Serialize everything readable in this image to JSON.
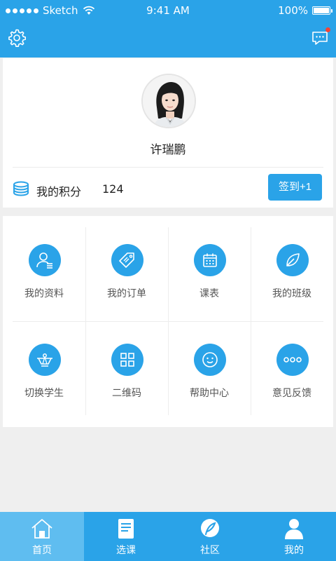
{
  "status_bar": {
    "carrier": "Sketch",
    "time": "9:41 AM",
    "battery": "100%"
  },
  "header": {
    "settings_icon": "gear-icon",
    "messages_icon": "message-icon",
    "has_unread": true
  },
  "profile": {
    "name": "许瑞鹏",
    "points_label": "我的积分",
    "points_value": "124",
    "checkin_label": "签到+1"
  },
  "menu": {
    "items": [
      {
        "label": "我的资料",
        "icon": "profile-icon"
      },
      {
        "label": "我的订单",
        "icon": "tag-icon"
      },
      {
        "label": "课表",
        "icon": "calendar-icon"
      },
      {
        "label": "我的班级",
        "icon": "leaf-icon"
      },
      {
        "label": "切换学生",
        "icon": "switch-icon"
      },
      {
        "label": "二维码",
        "icon": "qrcode-icon"
      },
      {
        "label": "帮助中心",
        "icon": "smile-icon"
      },
      {
        "label": "意见反馈",
        "icon": "more-icon"
      }
    ]
  },
  "tabbar": {
    "tabs": [
      {
        "label": "首页",
        "icon": "home-icon",
        "active": true
      },
      {
        "label": "选课",
        "icon": "course-icon",
        "active": false
      },
      {
        "label": "社区",
        "icon": "community-icon",
        "active": false
      },
      {
        "label": "我的",
        "icon": "user-icon",
        "active": false
      }
    ]
  },
  "colors": {
    "primary": "#2aa3e8",
    "active_tab": "#5fbdf0",
    "background": "#efefef",
    "badge": "#f44336"
  }
}
